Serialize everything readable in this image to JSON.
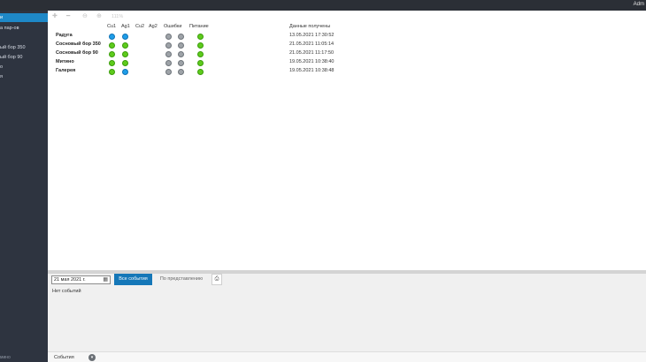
{
  "topbar": {
    "user": "Adm"
  },
  "sidebar": {
    "items": [
      {
        "label": "и",
        "active": true
      },
      {
        "label": "а пар-ов",
        "active": false
      },
      {
        "label": "ый бор 350",
        "active": false
      },
      {
        "label": "ый бор 90",
        "active": false
      },
      {
        "label": "о",
        "active": false
      },
      {
        "label": "я",
        "active": false
      }
    ],
    "footer": "мино"
  },
  "toolbar": {
    "zoom": "111%",
    "icons": [
      "plus-icon",
      "minus-icon",
      "zoom-out-icon",
      "zoom-in-icon"
    ]
  },
  "table": {
    "headers": {
      "cu1": "Cu1",
      "ag1": "Ag1",
      "cu2": "Cu2",
      "ag2": "Ag2",
      "errors": "Ошибки",
      "power": "Питание",
      "received": "Данные получены"
    },
    "rows": [
      {
        "name": "Радуга",
        "cu1": "blue",
        "ag1": "blue",
        "errors1": "gray",
        "errors2": "gray",
        "power": "green",
        "received": "13.05.2021 17:30:52"
      },
      {
        "name": "Сосновый бор 350",
        "cu1": "green",
        "ag1": "green",
        "errors1": "gray",
        "errors2": "gray",
        "power": "green",
        "received": "21.05.2021 11:05:14"
      },
      {
        "name": "Сосновый бор 90",
        "cu1": "green",
        "ag1": "green",
        "errors1": "gray",
        "errors2": "gray",
        "power": "green",
        "received": "21.05.2021 11:17:50"
      },
      {
        "name": "Митино",
        "cu1": "green",
        "ag1": "green",
        "errors1": "gray",
        "errors2": "gray",
        "power": "green",
        "received": "19.05.2021 10:38:40"
      },
      {
        "name": "Галерея",
        "cu1": "green",
        "ag1": "blue",
        "errors1": "gray",
        "errors2": "gray",
        "power": "green",
        "received": "19.05.2021 10:38:48"
      }
    ]
  },
  "events": {
    "date": "21 мая 2021 г.",
    "all_label": "Все события",
    "by_view_label": "По представлению",
    "empty_text": "Нет событий"
  },
  "bottom": {
    "label": "События"
  },
  "colors": {
    "accent": "#1577b8",
    "sidebar": "#2e3440",
    "active_item": "#1e88c8"
  }
}
